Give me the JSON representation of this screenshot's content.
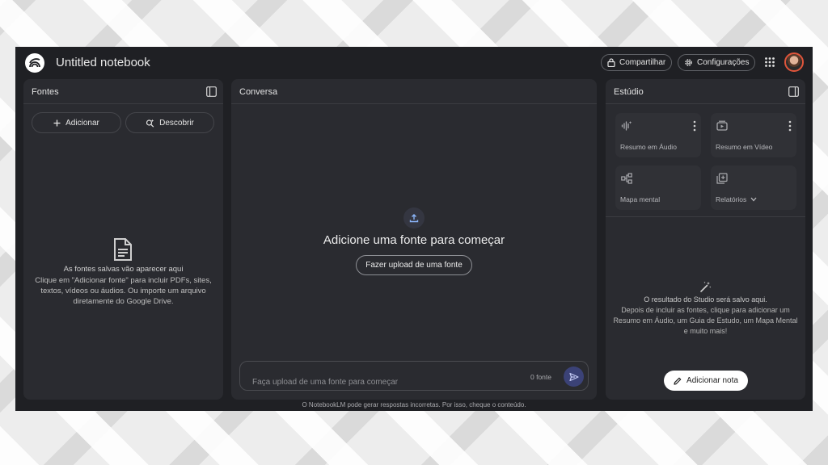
{
  "app": {
    "title": "Untitled notebook",
    "share_label": "Compartilhar",
    "settings_label": "Configurações",
    "accent_color": "#3b4277"
  },
  "icons": {
    "logo": "notebooklm-logo-icon",
    "share": "lock-icon",
    "settings": "gear-icon",
    "apps": "apps-grid-icon",
    "panel_toggle": "panel-toggle-icon",
    "add": "plus-icon",
    "discover": "search-sparkle-icon",
    "document": "document-icon",
    "upload": "upload-icon",
    "send": "send-icon",
    "audio": "audio-wave-icon",
    "video": "video-icon",
    "mindmap": "mind-map-icon",
    "reports": "reports-icon",
    "more": "more-vert-icon",
    "wand": "magic-wand-icon",
    "pencil": "pencil-icon"
  },
  "sources": {
    "title": "Fontes",
    "add_label": "Adicionar",
    "discover_label": "Descobrir",
    "empty_title": "As fontes salvas vão aparecer aqui",
    "empty_desc": "Clique em \"Adicionar fonte\" para incluir PDFs, sites, textos, vídeos ou áudios. Ou importe um arquivo diretamente do Google Drive."
  },
  "chat": {
    "title": "Conversa",
    "heading": "Adicione uma fonte para começar",
    "upload_label": "Fazer upload de uma fonte",
    "input_placeholder": "Faça upload de uma fonte para começar",
    "source_count": "0 fonte"
  },
  "studio": {
    "title": "Estúdio",
    "tiles": [
      {
        "label": "Resumo em Áudio"
      },
      {
        "label": "Resumo em Vídeo"
      },
      {
        "label": "Mapa mental"
      },
      {
        "label": "Relatórios"
      }
    ],
    "empty_title": "O resultado do Studio será salvo aqui.",
    "empty_desc": "Depois de incluir as fontes, clique para adicionar um Resumo em Áudio, um Guia de Estudo, um Mapa Mental e muito mais!",
    "add_note_label": "Adicionar nota"
  },
  "footer": {
    "disclaimer": "O NotebookLM pode gerar respostas incorretas. Por isso, cheque o conteúdo."
  }
}
